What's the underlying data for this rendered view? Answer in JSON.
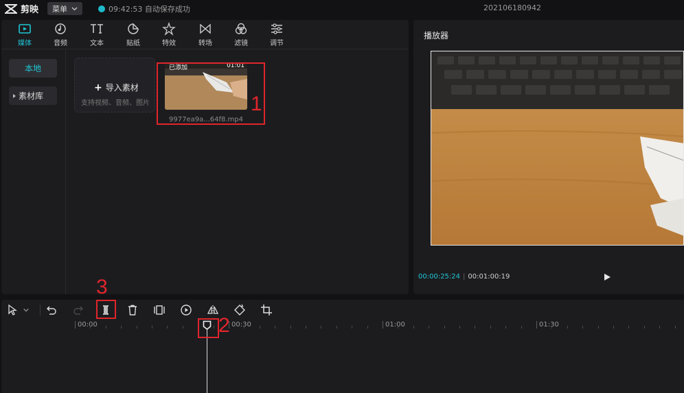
{
  "topbar": {
    "app_name": "剪映",
    "menu_label": "菜单",
    "save_status": "09:42:53 自动保存成功",
    "project_title": "202106180942",
    "accent": "#1fc6d6"
  },
  "media": {
    "tabs": [
      {
        "label": "媒体",
        "icon": "media-icon"
      },
      {
        "label": "音频",
        "icon": "audio-icon"
      },
      {
        "label": "文本",
        "icon": "text-icon"
      },
      {
        "label": "贴纸",
        "icon": "sticker-icon"
      },
      {
        "label": "特效",
        "icon": "effects-icon"
      },
      {
        "label": "转场",
        "icon": "transition-icon"
      },
      {
        "label": "滤镜",
        "icon": "filter-icon"
      },
      {
        "label": "调节",
        "icon": "adjust-icon"
      }
    ],
    "sidebar": {
      "local": "本地",
      "library": "素材库"
    },
    "import": {
      "label": "导入素材",
      "hint": "支持视频、音频、图片"
    },
    "clip": {
      "added_badge": "已添加",
      "duration": "01:01",
      "filename": "9977ea9a...64f8.mp4"
    }
  },
  "annotations": {
    "n1": "1",
    "n2": "2",
    "n3": "3",
    "color": "#e0252b"
  },
  "player": {
    "title": "播放器",
    "current_time": "00:00:25:24",
    "separator": "|",
    "total_time": "00:01:00:19"
  },
  "timeline": {
    "ruler": [
      "00:00",
      "00:30",
      "01:00",
      "01:30"
    ]
  }
}
